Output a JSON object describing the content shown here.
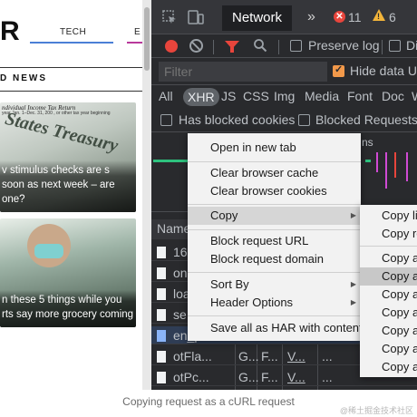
{
  "site": {
    "logo": "R",
    "nav": {
      "tech": "TECH",
      "next": "E"
    },
    "section_heading": "D NEWS",
    "articles": [
      {
        "image_text": "ndividual Income Tax Return",
        "image_subtext": "year Jan. 1–Dec. 31, 200 , or other tax year beginning",
        "image_mark": "States Treasury",
        "caption": "v stimulus checks are s soon as next week – are one?"
      },
      {
        "caption": "n these 5 things while you rts say more grocery coming"
      }
    ]
  },
  "devtools": {
    "main_tab": "Network",
    "more_tabs": "»",
    "errors": {
      "icon": "✕",
      "count": "11"
    },
    "warnings": {
      "icon": "!",
      "count": "6"
    },
    "kebab": "⋮",
    "toolbar": {
      "preserve_log": "Preserve log",
      "disable_cache": "Di"
    },
    "filter": {
      "placeholder": "Filter",
      "hide_data_urls": "Hide data UR"
    },
    "types": [
      "All",
      "XHR",
      "JS",
      "CSS",
      "Img",
      "Media",
      "Font",
      "Doc",
      "W"
    ],
    "active_type": "XHR",
    "blocked": {
      "has_blocked_cookies": "Has blocked cookies",
      "blocked_requests": "Blocked Requests"
    },
    "overview_label": "ns",
    "table": {
      "name_header": "Name",
      "rows": [
        {
          "name": "16",
          "cells": []
        },
        {
          "name": "on",
          "cells": []
        },
        {
          "name": "loa",
          "cells": []
        },
        {
          "name": "se",
          "cells": []
        },
        {
          "name": "en_p",
          "cells": []
        },
        {
          "name": "otFla...",
          "cells": [
            "G...",
            "F...",
            "V...",
            "..."
          ]
        },
        {
          "name": "otPc...",
          "cells": [
            "G...",
            "F...",
            "V...",
            "..."
          ]
        }
      ]
    }
  },
  "context_menu": {
    "items": [
      {
        "label": "Open in new tab"
      },
      {
        "label": "Clear browser cache"
      },
      {
        "label": "Clear browser cookies"
      },
      {
        "label": "Copy",
        "submenu": true
      },
      {
        "label": "Block request URL"
      },
      {
        "label": "Block request domain"
      },
      {
        "label": "Sort By",
        "submenu": true
      },
      {
        "label": "Header Options",
        "submenu": true
      },
      {
        "label": "Save all as HAR with content"
      }
    ],
    "submenu_arrow": "▶"
  },
  "copy_submenu": {
    "items": [
      {
        "label": "Copy lin"
      },
      {
        "label": "Copy re"
      },
      {
        "label": "Copy as"
      },
      {
        "label": "Copy as"
      },
      {
        "label": "Copy as"
      },
      {
        "label": "Copy al"
      },
      {
        "label": "Copy al"
      },
      {
        "label": "Copy al"
      },
      {
        "label": "Copy al"
      }
    ]
  },
  "caption": "Copying request as a cURL request",
  "watermark": "@稀土掘金技术社区",
  "colors": {
    "devtools_bg": "#292a2d",
    "record": "#e8453c",
    "warning": "#f2b43a",
    "checkbox_checked": "#f2994a",
    "menu_bg": "#f2f2f2",
    "menu_highlight": "#d6d6d6"
  }
}
